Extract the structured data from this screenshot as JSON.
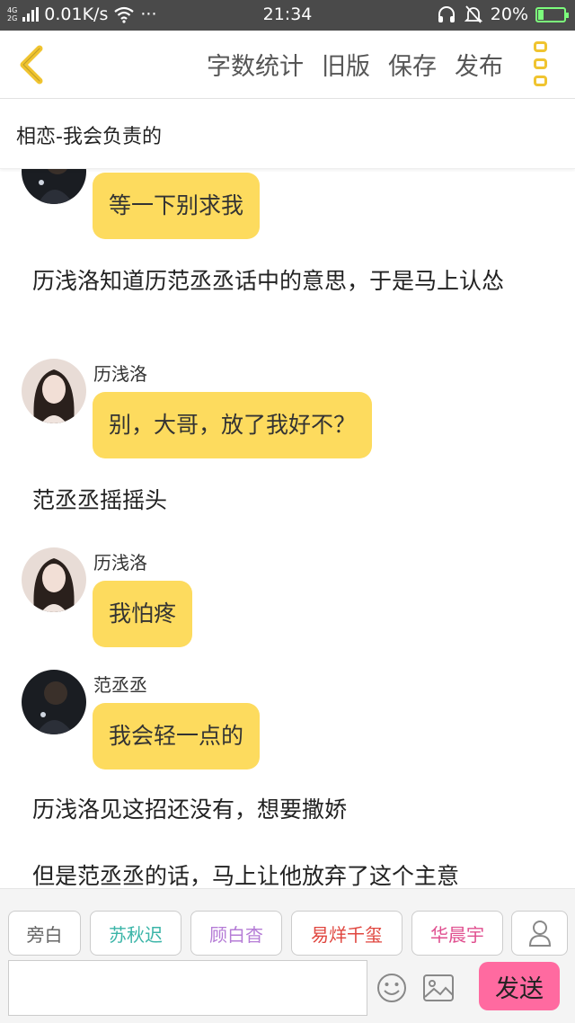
{
  "status_bar": {
    "net_top": "4G",
    "net_bottom": "2G",
    "speed": "0.01K/s",
    "dots": "···",
    "time": "21:34",
    "battery": "20%"
  },
  "nav": {
    "actions": [
      "字数统计",
      "旧版",
      "保存",
      "发布"
    ]
  },
  "story_title": "相恋-我会负责的",
  "messages": [
    {
      "sender": "",
      "text": "等一下别求我"
    },
    {
      "narration": "历浅洛知道历范丞丞话中的意思，于是马上认怂"
    },
    {
      "sender": "历浅洛",
      "text": "别，大哥，放了我好不？"
    },
    {
      "narration": "范丞丞摇摇头"
    },
    {
      "sender": "历浅洛",
      "text": "我怕疼"
    },
    {
      "sender": "范丞丞",
      "text": "我会轻一点的"
    },
    {
      "narration": "历浅洛见这招还没有，想要撒娇"
    },
    {
      "narration": "但是范丞丞的话，马上让他放弃了这个主意"
    }
  ],
  "characters": [
    {
      "name": "旁白",
      "color": "#666666"
    },
    {
      "name": "苏秋迟",
      "color": "#3bb5a8"
    },
    {
      "name": "顾白杳",
      "color": "#b57cd6"
    },
    {
      "name": "易烊千玺",
      "color": "#e0463f"
    },
    {
      "name": "华晨宇",
      "color": "#e04f8f"
    }
  ],
  "composer": {
    "input_value": "",
    "send_label": "发送"
  },
  "colors": {
    "accent": "#f0c430",
    "bubble": "#fddb5e",
    "send": "#ff6aa0"
  }
}
